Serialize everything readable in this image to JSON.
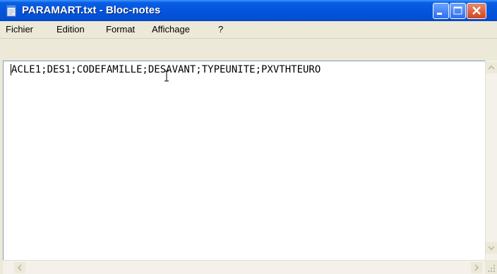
{
  "window": {
    "title": "PARAMART.txt - Bloc-notes",
    "colors": {
      "titlebar": "#0454dc",
      "close_button": "#d1461f",
      "menubar": "#ece9d8",
      "client": "#ffffff"
    }
  },
  "titlebar_buttons": {
    "minimize_icon": "minimize-icon",
    "maximize_icon": "maximize-icon",
    "close_icon": "close-icon"
  },
  "menu": {
    "items": [
      "Fichier",
      "Edition",
      "Format",
      "Affichage",
      "?"
    ]
  },
  "editor": {
    "content": "ACLE1;DES1;CODEFAMILLE;DESAVANT;TYPEUNITE;PXVTHTEURO"
  }
}
